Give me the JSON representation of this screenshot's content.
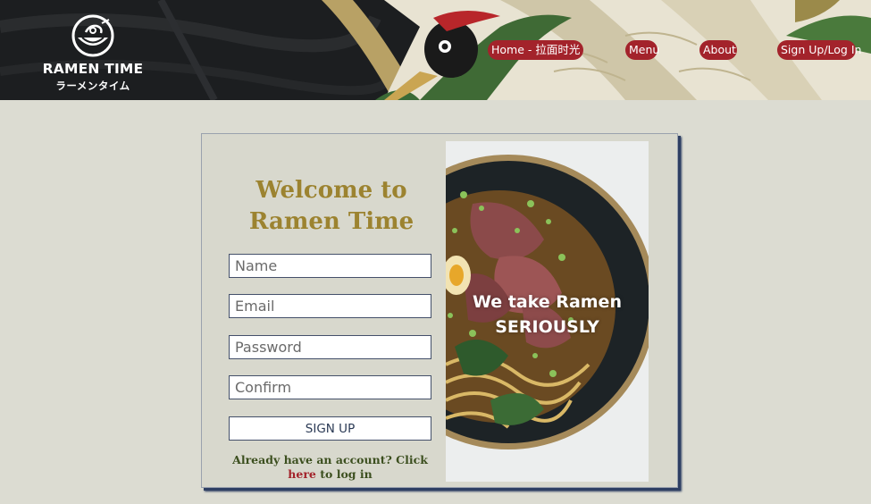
{
  "brand": {
    "title": "RAMEN TIME",
    "subtitle": "ラーメンタイム"
  },
  "nav": {
    "items": [
      {
        "label": "Home - 拉面时光"
      },
      {
        "label": "Menu"
      },
      {
        "label": "About"
      },
      {
        "label": "Sign Up/Log In"
      }
    ]
  },
  "signup": {
    "heading_line1": "Welcome to",
    "heading_line2": "Ramen Time",
    "fields": {
      "name_placeholder": "Name",
      "email_placeholder": "Email",
      "password_placeholder": "Password",
      "confirm_placeholder": "Confirm"
    },
    "submit_label": "SIGN UP",
    "login_prompt": "Already have an account? Click",
    "login_link": "here",
    "login_suffix": " to log in"
  },
  "hero_image": {
    "tagline_line1": "We take Ramen",
    "tagline_line2": "SERIOUSLY"
  },
  "colors": {
    "page_background": "#dcdcd2",
    "accent_red": "#a3232b",
    "heading_gold": "#9c8330",
    "card_shadow_navy": "#2e3f63",
    "login_text_green": "#3c4f1f"
  }
}
